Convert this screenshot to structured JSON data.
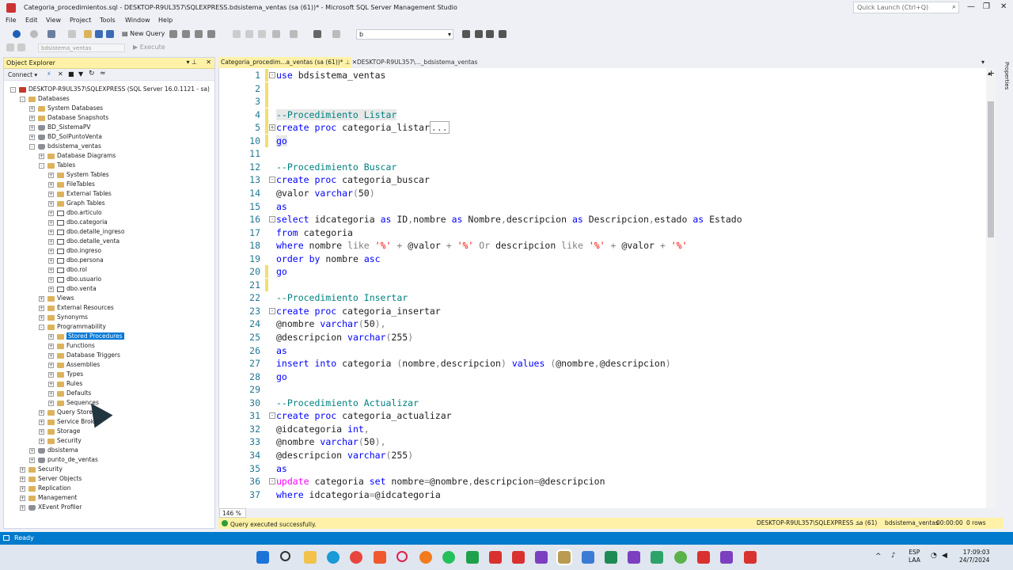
{
  "window": {
    "title": "Categoria_procedimientos.sql - DESKTOP-R9UL357\\SQLEXPRESS.bdsistema_ventas (sa (61))* - Microsoft SQL Server Management Studio",
    "quick_launch_placeholder": "Quick Launch (Ctrl+Q)"
  },
  "menu": [
    "File",
    "Edit",
    "View",
    "Project",
    "Tools",
    "Window",
    "Help"
  ],
  "toolbar": {
    "new_query": "New Query",
    "db_search_value": "b",
    "current_db": "bdsistema_ventas",
    "execute": "Execute"
  },
  "object_explorer": {
    "title": "Object Explorer",
    "connect": "Connect",
    "nodes": [
      {
        "label": "DESKTOP-R9UL357\\SQLEXPRESS (SQL Server 16.0.1121 - sa)",
        "indent": 0,
        "exp": "-",
        "icon": "server"
      },
      {
        "label": "Databases",
        "indent": 1,
        "exp": "-",
        "icon": "folder"
      },
      {
        "label": "System Databases",
        "indent": 2,
        "exp": "+",
        "icon": "folder"
      },
      {
        "label": "Database Snapshots",
        "indent": 2,
        "exp": "+",
        "icon": "folder"
      },
      {
        "label": "BD_SistemaPV",
        "indent": 2,
        "exp": "+",
        "icon": "db"
      },
      {
        "label": "BD_SolPuntoVenta",
        "indent": 2,
        "exp": "+",
        "icon": "db"
      },
      {
        "label": "bdsistema_ventas",
        "indent": 2,
        "exp": "-",
        "icon": "db"
      },
      {
        "label": "Database Diagrams",
        "indent": 3,
        "exp": "+",
        "icon": "folder"
      },
      {
        "label": "Tables",
        "indent": 3,
        "exp": "-",
        "icon": "folder"
      },
      {
        "label": "System Tables",
        "indent": 4,
        "exp": "+",
        "icon": "folder"
      },
      {
        "label": "FileTables",
        "indent": 4,
        "exp": "+",
        "icon": "folder"
      },
      {
        "label": "External Tables",
        "indent": 4,
        "exp": "+",
        "icon": "folder"
      },
      {
        "label": "Graph Tables",
        "indent": 4,
        "exp": "+",
        "icon": "folder"
      },
      {
        "label": "dbo.articulo",
        "indent": 4,
        "exp": "+",
        "icon": "table"
      },
      {
        "label": "dbo.categoria",
        "indent": 4,
        "exp": "+",
        "icon": "table"
      },
      {
        "label": "dbo.detalle_ingreso",
        "indent": 4,
        "exp": "+",
        "icon": "table"
      },
      {
        "label": "dbo.detalle_venta",
        "indent": 4,
        "exp": "+",
        "icon": "table"
      },
      {
        "label": "dbo.ingreso",
        "indent": 4,
        "exp": "+",
        "icon": "table"
      },
      {
        "label": "dbo.persona",
        "indent": 4,
        "exp": "+",
        "icon": "table"
      },
      {
        "label": "dbo.rol",
        "indent": 4,
        "exp": "+",
        "icon": "table"
      },
      {
        "label": "dbo.usuario",
        "indent": 4,
        "exp": "+",
        "icon": "table"
      },
      {
        "label": "dbo.venta",
        "indent": 4,
        "exp": "+",
        "icon": "table"
      },
      {
        "label": "Views",
        "indent": 3,
        "exp": "+",
        "icon": "folder"
      },
      {
        "label": "External Resources",
        "indent": 3,
        "exp": "+",
        "icon": "folder"
      },
      {
        "label": "Synonyms",
        "indent": 3,
        "exp": "+",
        "icon": "folder"
      },
      {
        "label": "Programmability",
        "indent": 3,
        "exp": "-",
        "icon": "folder"
      },
      {
        "label": "Stored Procedures",
        "indent": 4,
        "exp": "+",
        "icon": "folder",
        "selected": true
      },
      {
        "label": "Functions",
        "indent": 4,
        "exp": "+",
        "icon": "folder"
      },
      {
        "label": "Database Triggers",
        "indent": 4,
        "exp": "+",
        "icon": "folder"
      },
      {
        "label": "Assemblies",
        "indent": 4,
        "exp": "+",
        "icon": "folder"
      },
      {
        "label": "Types",
        "indent": 4,
        "exp": "+",
        "icon": "folder"
      },
      {
        "label": "Rules",
        "indent": 4,
        "exp": "+",
        "icon": "folder"
      },
      {
        "label": "Defaults",
        "indent": 4,
        "exp": "+",
        "icon": "folder"
      },
      {
        "label": "Sequences",
        "indent": 4,
        "exp": "+",
        "icon": "folder"
      },
      {
        "label": "Query Store",
        "indent": 3,
        "exp": "+",
        "icon": "folder"
      },
      {
        "label": "Service Broker",
        "indent": 3,
        "exp": "+",
        "icon": "folder"
      },
      {
        "label": "Storage",
        "indent": 3,
        "exp": "+",
        "icon": "folder"
      },
      {
        "label": "Security",
        "indent": 3,
        "exp": "+",
        "icon": "folder"
      },
      {
        "label": "dbsistema",
        "indent": 2,
        "exp": "+",
        "icon": "db"
      },
      {
        "label": "punto_de_ventas",
        "indent": 2,
        "exp": "+",
        "icon": "db"
      },
      {
        "label": "Security",
        "indent": 1,
        "exp": "+",
        "icon": "folder"
      },
      {
        "label": "Server Objects",
        "indent": 1,
        "exp": "+",
        "icon": "folder"
      },
      {
        "label": "Replication",
        "indent": 1,
        "exp": "+",
        "icon": "folder"
      },
      {
        "label": "Management",
        "indent": 1,
        "exp": "+",
        "icon": "folder"
      },
      {
        "label": "XEvent Profiler",
        "indent": 1,
        "exp": "+",
        "icon": "xevent"
      }
    ]
  },
  "tabs": {
    "active": "Categoria_procedim...a_ventas (sa (61))*",
    "second": "DESKTOP-R9UL357\\..._bdsistema_ventas"
  },
  "editor": {
    "zoom": "146 %",
    "lines": [
      {
        "n": "1",
        "html": "<span class='kw'>use</span> bdsistema_ventas",
        "fold": "-",
        "mark": true
      },
      {
        "n": "2",
        "html": "",
        "mark": true
      },
      {
        "n": "3",
        "html": "",
        "mark": true
      },
      {
        "n": "4",
        "html": "<span class='cm hl'>--Procedimiento Listar</span>",
        "mark": true
      },
      {
        "n": "5",
        "html": "<span class='kw'>create</span> <span class='kw'>proc</span> categoria_listar<span class='coll'>...</span>",
        "fold": "+",
        "mark": true
      },
      {
        "n": "10",
        "html": "<span class='kw hl'>go</span>",
        "mark": true
      },
      {
        "n": "11",
        "html": ""
      },
      {
        "n": "12",
        "html": "<span class='cm'>--Procedimiento Buscar</span>"
      },
      {
        "n": "13",
        "html": "<span class='kw'>create</span> <span class='kw'>proc</span> categoria_buscar",
        "fold": "-"
      },
      {
        "n": "14",
        "html": "@valor <span class='kw'>varchar</span><span class='gr'>(</span>50<span class='gr'>)</span>"
      },
      {
        "n": "15",
        "html": "<span class='kw'>as</span>"
      },
      {
        "n": "16",
        "html": "<span class='kw'>select</span> idcategoria <span class='kw'>as</span> ID<span class='gr'>,</span>nombre <span class='kw'>as</span> Nombre<span class='gr'>,</span>descripcion <span class='kw'>as</span> Descripcion<span class='gr'>,</span>estado <span class='kw'>as</span> Estado",
        "fold": "-"
      },
      {
        "n": "17",
        "html": "<span class='kw'>from</span> categoria"
      },
      {
        "n": "18",
        "html": "<span class='kw'>where</span> nombre <span class='gr'>like</span> <span class='st'>'%'</span> <span class='gr'>+</span> @valor <span class='gr'>+</span> <span class='st'>'%'</span> <span class='gr'>Or</span> descripcion <span class='gr'>like</span> <span class='st'>'%'</span> <span class='gr'>+</span> @valor <span class='gr'>+</span> <span class='st'>'%'</span>"
      },
      {
        "n": "19",
        "html": "<span class='kw'>order</span> <span class='kw'>by</span> nombre <span class='kw'>asc</span>"
      },
      {
        "n": "20",
        "html": "<span class='kw'>go</span>",
        "mark": true
      },
      {
        "n": "21",
        "html": "",
        "mark": true
      },
      {
        "n": "22",
        "html": "<span class='cm'>--Procedimiento Insertar</span>"
      },
      {
        "n": "23",
        "html": "<span class='kw'>create</span> <span class='kw'>proc</span> categoria_insertar",
        "fold": "-"
      },
      {
        "n": "24",
        "html": "@nombre <span class='kw'>varchar</span><span class='gr'>(</span>50<span class='gr'>),</span>"
      },
      {
        "n": "25",
        "html": "@descripcion <span class='kw'>varchar</span><span class='gr'>(</span>255<span class='gr'>)</span>"
      },
      {
        "n": "26",
        "html": "<span class='kw'>as</span>"
      },
      {
        "n": "27",
        "html": "<span class='kw'>insert</span> <span class='kw'>into</span> categoria <span class='gr'>(</span>nombre<span class='gr'>,</span>descripcion<span class='gr'>)</span> <span class='kw'>values</span> <span class='gr'>(</span>@nombre<span class='gr'>,</span>@descripcion<span class='gr'>)</span>"
      },
      {
        "n": "28",
        "html": "<span class='kw'>go</span>"
      },
      {
        "n": "29",
        "html": ""
      },
      {
        "n": "30",
        "html": "<span class='cm'>--Procedimiento Actualizar</span>"
      },
      {
        "n": "31",
        "html": "<span class='kw'>create</span> <span class='kw'>proc</span> categoria_actualizar",
        "fold": "-"
      },
      {
        "n": "32",
        "html": "@idcategoria <span class='kw'>int</span><span class='gr'>,</span>"
      },
      {
        "n": "33",
        "html": "@nombre <span class='kw'>varchar</span><span class='gr'>(</span>50<span class='gr'>),</span>"
      },
      {
        "n": "34",
        "html": "@descripcion <span class='kw'>varchar</span><span class='gr'>(</span>255<span class='gr'>)</span>"
      },
      {
        "n": "35",
        "html": "<span class='kw'>as</span>"
      },
      {
        "n": "36",
        "html": "<span class='fn'>update</span> categoria <span class='kw'>set</span> nombre<span class='gr'>=</span>@nombre<span class='gr'>,</span>descripcion<span class='gr'>=</span>@descripcion",
        "fold": "-"
      },
      {
        "n": "37",
        "html": "<span class='kw'>where</span> idcategoria<span class='gr'>=</span>@idcategoria"
      }
    ]
  },
  "editor_status": {
    "message": "Query executed successfully.",
    "server": "DESKTOP-R9UL357\\SQLEXPRESS ...",
    "user": "sa (61)",
    "database": "bdsistema_ventas",
    "time": "00:00:00",
    "rows": "0 rows"
  },
  "statusbar": {
    "text": "Ready"
  },
  "taskbar": {
    "lang_top": "ESP",
    "lang_bottom": "LAA",
    "time": "17:09:03",
    "date": "24/7/2024"
  },
  "colors": {
    "accent": "#007acc",
    "tab_active": "#fff2a8",
    "keyword": "#0000ff",
    "comment": "#008080",
    "string": "#ff0000"
  }
}
